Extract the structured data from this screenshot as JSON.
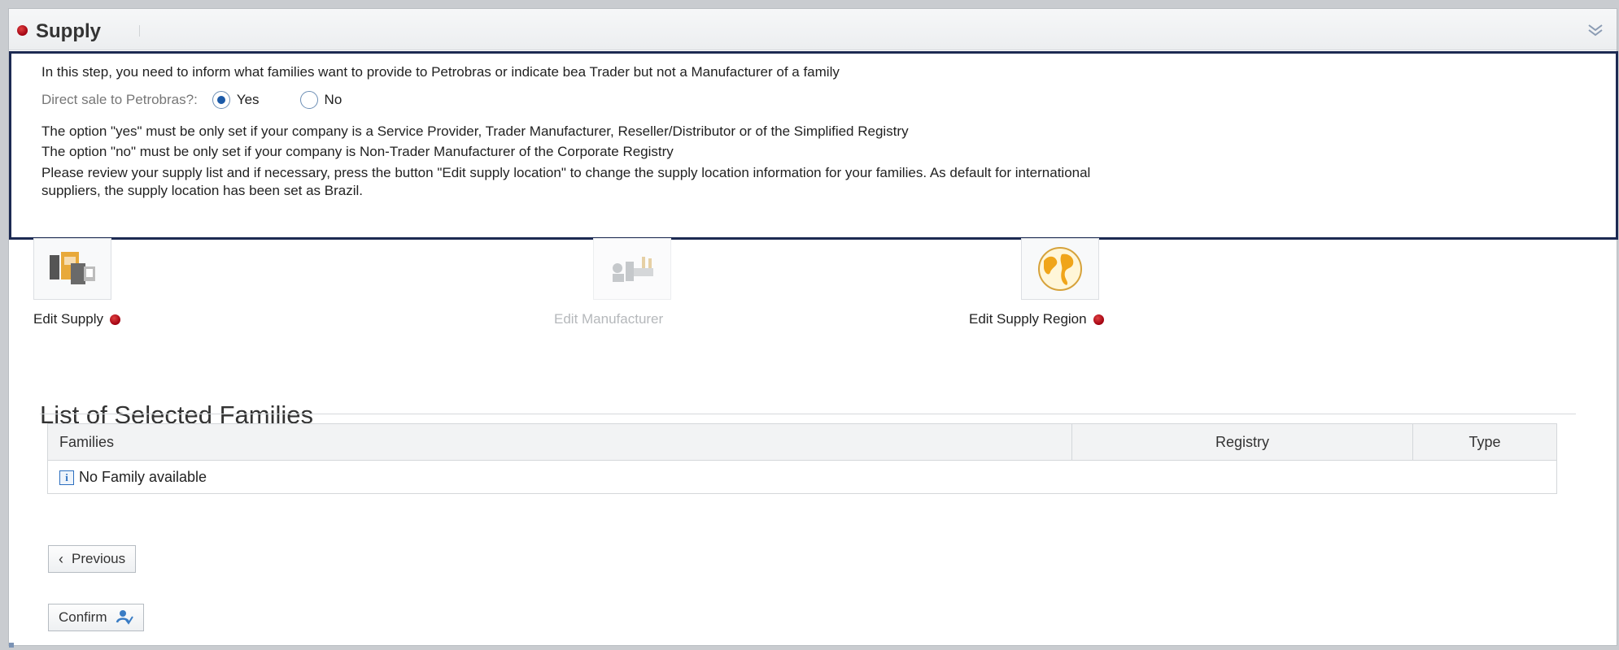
{
  "header": {
    "title": "Supply",
    "collapse_icon": "double-chevron-down-icon"
  },
  "intro": {
    "instruction": "In this step, you need to inform what families want to provide to Petrobras or indicate bea Trader but not a Manufacturer of a family",
    "direct_sale_label": "Direct sale to Petrobras?:",
    "options": [
      {
        "label": "Yes",
        "selected": true
      },
      {
        "label": "No",
        "selected": false
      }
    ],
    "note_yes": "The option \"yes\" must be only set if your company is a Service Provider, Trader Manufacturer, Reseller/Distributor or of the Simplified Registry",
    "note_no": "The option \"no\" must be only set if your company is Non-Trader Manufacturer of the Corporate Registry",
    "review_line1": "Please review your supply list and if necessary, press the button \"Edit supply location\" to change the supply location information for your families. As default for international",
    "review_line2": "suppliers, the supply location has been set as Brazil."
  },
  "actions": [
    {
      "label": "Edit Supply",
      "icon": "supply-boxes-icon",
      "status": "incomplete",
      "enabled": true
    },
    {
      "label": "Edit Manufacturer",
      "icon": "manufacturer-factory-icon",
      "status": "",
      "enabled": false
    },
    {
      "label": "Edit Supply Region",
      "icon": "globe-icon",
      "status": "incomplete",
      "enabled": true
    }
  ],
  "families": {
    "title": "List of Selected Families",
    "columns": [
      "Families",
      "Registry",
      "Type"
    ],
    "empty_message": "No Family available"
  },
  "buttons": {
    "previous": "Previous",
    "confirm": "Confirm"
  },
  "colors": {
    "status_red": "#c0101c",
    "frame_navy": "#1c2a52",
    "radio_blue": "#1b5aa8"
  }
}
